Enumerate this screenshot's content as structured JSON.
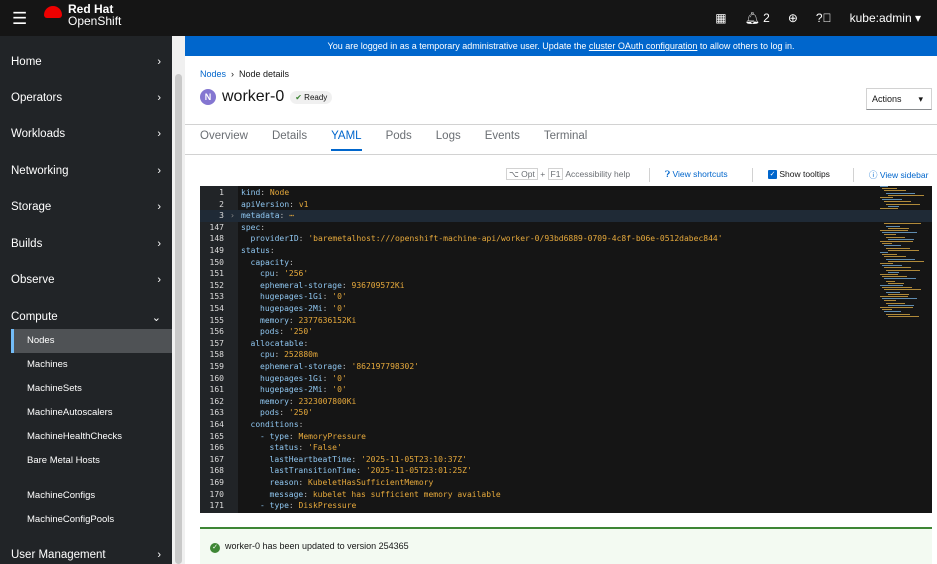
{
  "masthead": {
    "brand_line1": "Red Hat",
    "brand_line2": "OpenShift",
    "notifications": "2",
    "user": "kube:admin"
  },
  "sidebar": {
    "sections": [
      {
        "label": "Home",
        "y": 56
      },
      {
        "label": "Operators"
      },
      {
        "label": "Workloads"
      },
      {
        "label": "Networking"
      },
      {
        "label": "Storage"
      },
      {
        "label": "Builds"
      },
      {
        "label": "Observe"
      },
      {
        "label": "Compute"
      }
    ],
    "compute_items": [
      "Nodes",
      "Machines",
      "MachineSets",
      "MachineAutoscalers",
      "MachineHealthChecks",
      "Bare Metal Hosts",
      "MachineConfigs",
      "MachineConfigPools"
    ],
    "bottom": "User Management"
  },
  "banner": {
    "text": "You are logged in as a temporary administrative user. Update the ",
    "link": "cluster OAuth configuration",
    "suffix": " to allow others to log in."
  },
  "breadcrumb": {
    "parent": "Nodes",
    "current": "Node details"
  },
  "node": {
    "badge": "N",
    "name": "worker-0",
    "status": "Ready"
  },
  "actions_label": "Actions",
  "tabs": [
    "Overview",
    "Details",
    "YAML",
    "Pods",
    "Logs",
    "Events",
    "Terminal"
  ],
  "active_tab": "YAML",
  "toolbar": {
    "key1": "⌥ Opt",
    "key2": "F1",
    "a11y": "Accessibility help",
    "shortcuts": "View shortcuts",
    "tooltips": "Show tooltips",
    "sidebar": "View sidebar"
  },
  "yaml": [
    [
      "1",
      0,
      "kind",
      "Node"
    ],
    [
      "2",
      0,
      "apiVersion",
      "v1"
    ],
    [
      "3",
      0,
      "metadata",
      "⋯"
    ],
    [
      "147",
      0,
      "spec",
      ""
    ],
    [
      "148",
      1,
      "providerID",
      "'baremetalhost:///openshift-machine-api/worker-0/93bd6889-0709-4c8f-b06e-0512dabec844'"
    ],
    [
      "149",
      0,
      "status",
      ""
    ],
    [
      "150",
      1,
      "capacity",
      ""
    ],
    [
      "151",
      2,
      "cpu",
      "'256'"
    ],
    [
      "152",
      2,
      "ephemeral-storage",
      "936709572Ki"
    ],
    [
      "153",
      2,
      "hugepages-1Gi",
      "'0'"
    ],
    [
      "154",
      2,
      "hugepages-2Mi",
      "'0'"
    ],
    [
      "155",
      2,
      "memory",
      "2377636152Ki"
    ],
    [
      "156",
      2,
      "pods",
      "'250'"
    ],
    [
      "157",
      1,
      "allocatable",
      ""
    ],
    [
      "158",
      2,
      "cpu",
      "252880m"
    ],
    [
      "159",
      2,
      "ephemeral-storage",
      "'862197798302'"
    ],
    [
      "160",
      2,
      "hugepages-1Gi",
      "'0'"
    ],
    [
      "161",
      2,
      "hugepages-2Mi",
      "'0'"
    ],
    [
      "162",
      2,
      "memory",
      "2323007800Ki"
    ],
    [
      "163",
      2,
      "pods",
      "'250'"
    ],
    [
      "164",
      1,
      "conditions",
      ""
    ],
    [
      "165",
      2,
      "- type",
      "MemoryPressure"
    ],
    [
      "166",
      3,
      "status",
      "'False'"
    ],
    [
      "167",
      3,
      "lastHeartbeatTime",
      "'2025-11-05T23:10:37Z'"
    ],
    [
      "168",
      3,
      "lastTransitionTime",
      "'2025-11-05T23:01:25Z'"
    ],
    [
      "169",
      3,
      "reason",
      "KubeletHasSufficientMemory"
    ],
    [
      "170",
      3,
      "message",
      "kubelet has sufficient memory available"
    ],
    [
      "171",
      2,
      "- type",
      "DiskPressure"
    ]
  ],
  "alert": "worker-0 has been updated to version 254365"
}
